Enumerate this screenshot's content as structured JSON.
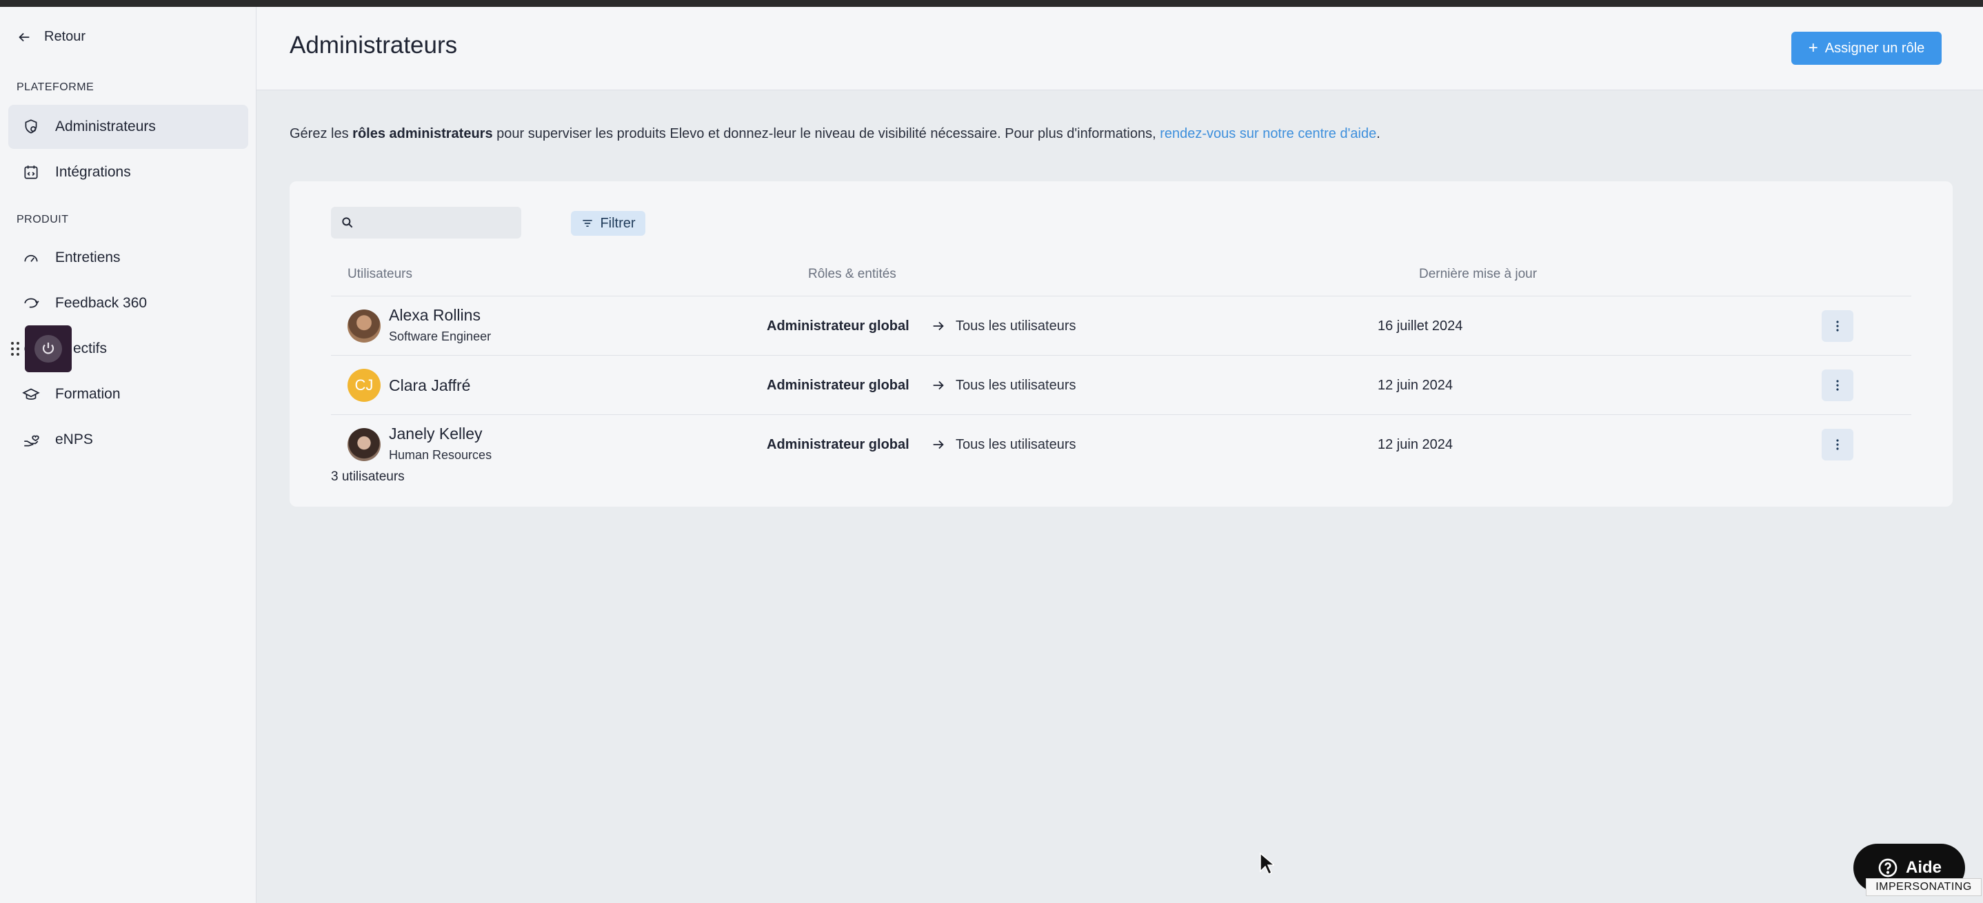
{
  "sidebar": {
    "back_label": "Retour",
    "sections": {
      "platform": "PLATEFORME",
      "product": "PRODUIT"
    },
    "platform_items": [
      {
        "label": "Administrateurs",
        "icon": "shield-settings-icon",
        "active": true
      },
      {
        "label": "Intégrations",
        "icon": "integration-icon",
        "active": false
      }
    ],
    "product_items": [
      {
        "label": "Entretiens",
        "icon": "speedometer-icon"
      },
      {
        "label": "Feedback 360",
        "icon": "cycle-arrows-icon"
      },
      {
        "label": "ectifs",
        "icon": "target-icon"
      },
      {
        "label": "Formation",
        "icon": "graduation-cap-icon"
      },
      {
        "label": "eNPS",
        "icon": "hand-heart-icon"
      }
    ]
  },
  "header": {
    "title": "Administrateurs",
    "assign_button": "Assigner un rôle"
  },
  "intro": {
    "prefix": "Gérez les ",
    "bold": "rôles administrateurs",
    "middle": " pour superviser les produits Elevo et donnez-leur le niveau de visibilité nécessaire. Pour plus d'informations, ",
    "link": "rendez-vous sur notre centre d'aide",
    "suffix": "."
  },
  "table": {
    "search_placeholder": "",
    "filter_label": "Filtrer",
    "columns": [
      "Utilisateurs",
      "Rôles & entités",
      "Dernière mise à jour"
    ],
    "rows": [
      {
        "name": "Alexa Rollins",
        "job": "Software Engineer",
        "initials": "",
        "role": "Administrateur global",
        "scope": "Tous les utilisateurs",
        "updated": "16 juillet 2024"
      },
      {
        "name": "Clara Jaffré",
        "job": "",
        "initials": "CJ",
        "role": "Administrateur global",
        "scope": "Tous les utilisateurs",
        "updated": "12 juin 2024"
      },
      {
        "name": "Janely Kelley",
        "job": "Human Resources",
        "initials": "",
        "role": "Administrateur global",
        "scope": "Tous les utilisateurs",
        "updated": "12 juin 2024"
      }
    ],
    "count": "3 utilisateurs"
  },
  "help": {
    "label": "Aide",
    "impersonating": "IMPERSONATING"
  },
  "colors": {
    "accent": "#3d96ea",
    "avatar_cj": "#f2b632",
    "impersonate_bg": "#2f1d33"
  }
}
